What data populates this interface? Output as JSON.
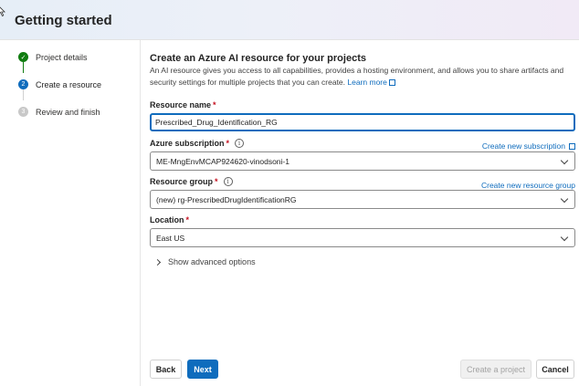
{
  "header": {
    "title": "Getting started"
  },
  "steps": [
    {
      "number": "✓",
      "label": "Project details",
      "state": "done"
    },
    {
      "number": "2",
      "label": "Create a resource",
      "state": "active"
    },
    {
      "number": "3",
      "label": "Review and finish",
      "state": "todo"
    }
  ],
  "main": {
    "title": "Create an Azure AI resource for your projects",
    "description": "An AI resource gives you access to all capabilities, provides a hosting environment, and allows you to share artifacts and security settings for multiple projects that you can create.",
    "learn_more": "Learn more"
  },
  "fields": {
    "resource_name": {
      "label": "Resource name",
      "required": "*",
      "value": "Prescribed_Drug_Identification_RG"
    },
    "subscription": {
      "label": "Azure subscription",
      "required": "*",
      "value": "ME-MngEnvMCAP924620-vinodsoni-1",
      "link": "Create new subscription"
    },
    "resource_group": {
      "label": "Resource group",
      "required": "*",
      "value": "(new) rg-PrescribedDrugIdentificationRG",
      "link": "Create new resource group"
    },
    "location": {
      "label": "Location",
      "required": "*",
      "value": "East US"
    }
  },
  "advanced_label": "Show advanced options",
  "buttons": {
    "back": "Back",
    "next": "Next",
    "create": "Create a project",
    "cancel": "Cancel"
  },
  "colors": {
    "accent": "#0f6cbd",
    "success": "#107c10",
    "required": "#c50f1f"
  }
}
